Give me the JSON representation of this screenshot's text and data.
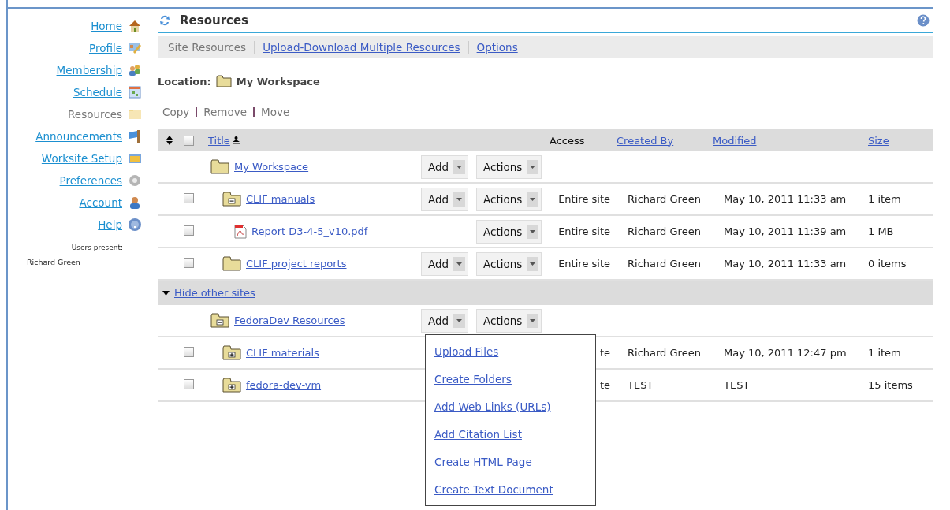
{
  "sidebar": {
    "items": [
      {
        "label": "Home",
        "selected": false
      },
      {
        "label": "Profile",
        "selected": false
      },
      {
        "label": "Membership",
        "selected": false
      },
      {
        "label": "Schedule",
        "selected": false
      },
      {
        "label": "Resources",
        "selected": true
      },
      {
        "label": "Announcements",
        "selected": false
      },
      {
        "label": "Worksite Setup",
        "selected": false
      },
      {
        "label": "Preferences",
        "selected": false
      },
      {
        "label": "Account",
        "selected": false
      },
      {
        "label": "Help",
        "selected": false
      }
    ],
    "users_label": "Users present:",
    "users": [
      "Richard Green"
    ]
  },
  "header": {
    "title": "Resources"
  },
  "nav": [
    {
      "label": "Site Resources",
      "selected": true
    },
    {
      "label": "Upload-Download Multiple Resources",
      "selected": false
    },
    {
      "label": "Options",
      "selected": false
    }
  ],
  "location": {
    "label": "Location:",
    "value": "My Workspace"
  },
  "actions": [
    "Copy",
    "Remove",
    "Move"
  ],
  "table": {
    "select_all_checked": false,
    "columns": [
      {
        "label": "Title",
        "link": true
      },
      {
        "label": "Access",
        "link": false
      },
      {
        "label": "Created By",
        "link": true
      },
      {
        "label": "Modified",
        "link": true
      },
      {
        "label": "Size",
        "link": true
      }
    ],
    "rows": [
      {
        "kind": "folder",
        "title": "My Workspace",
        "buttons": [
          "Add",
          "Actions"
        ],
        "children": [
          {
            "kind": "folder-open",
            "title": "CLIF manuals",
            "checked": false,
            "buttons": [
              "Add",
              "Actions"
            ],
            "access": "Entire site",
            "created_by": "Richard Green",
            "modified": "May 10, 2011 11:33 am",
            "size": "1 item",
            "children": [
              {
                "kind": "pdf",
                "title": "Report D3-4-5_v10.pdf",
                "checked": false,
                "buttons": [
                  "Actions"
                ],
                "access": "Entire site",
                "created_by": "Richard Green",
                "modified": "May 10, 2011 11:39 am",
                "size": "1 MB"
              }
            ]
          },
          {
            "kind": "folder",
            "title": "CLIF project reports",
            "checked": false,
            "buttons": [
              "Add",
              "Actions"
            ],
            "access": "Entire site",
            "created_by": "Richard Green",
            "modified": "May 10, 2011 11:33 am",
            "size": "0 items"
          }
        ]
      },
      {
        "kind": "group",
        "title": "Hide other sites",
        "expanded": true
      },
      {
        "kind": "folder-open",
        "title": "FedoraDev Resources",
        "buttons": [
          "Add",
          "Actions"
        ],
        "menu": [
          "Upload Files",
          "Create Folders",
          "Add Web Links (URLs)",
          "Add Citation List",
          "Create HTML Page",
          "Create Text Document"
        ],
        "children": [
          {
            "kind": "folder-plus",
            "title": "CLIF materials",
            "checked": false,
            "access": "te",
            "created_by": "Richard Green",
            "modified": "May 10, 2011 12:47 pm",
            "size": "1 item"
          },
          {
            "kind": "folder-plus",
            "title": "fedora-dev-vm",
            "checked": false,
            "access": "te",
            "created_by": "TEST",
            "modified": "TEST",
            "size": "15 items"
          }
        ]
      }
    ]
  }
}
